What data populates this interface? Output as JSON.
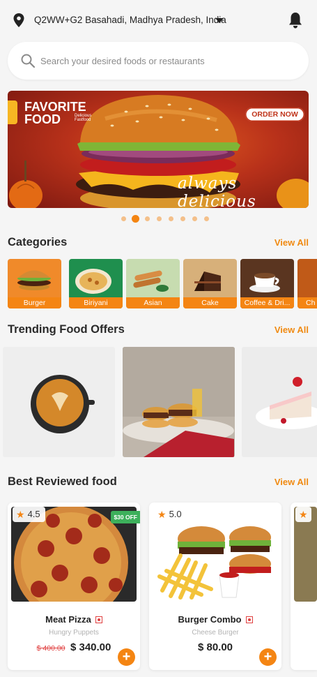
{
  "location": {
    "address": "Q2WW+G2 Basahadi, Madhya Pradesh, India",
    "icon": "location-pin-icon"
  },
  "header": {
    "notification_icon": "bell-icon"
  },
  "search": {
    "placeholder": "Search your desired foods or restaurants",
    "icon": "search-icon"
  },
  "banner": {
    "brand_line1": "FAVORITE",
    "brand_line2": "FOOD",
    "brand_sub": "Delicious Fastfood",
    "cta": "ORDER NOW",
    "tagline": "always delicious",
    "slides_total": 8,
    "active_slide": 2
  },
  "categories": {
    "title": "Categories",
    "view_all": "View All",
    "items": [
      {
        "label": "Burger"
      },
      {
        "label": "Biriyani"
      },
      {
        "label": "Asian"
      },
      {
        "label": "Cake"
      },
      {
        "label": "Coffee & Dri..."
      },
      {
        "label": "Ch"
      }
    ]
  },
  "trending": {
    "title": "Trending Food Offers",
    "view_all": "View All"
  },
  "best_reviewed": {
    "title": "Best Reviewed food",
    "view_all": "View All",
    "items": [
      {
        "rating": "4.5",
        "discount": "$30 OFF",
        "name": "Meat Pizza",
        "restaurant": "Hungry Puppets",
        "old_price": "$ 400.00",
        "price": "$ 340.00"
      },
      {
        "rating": "5.0",
        "discount": "",
        "name": "Burger Combo",
        "restaurant": "Cheese Burger",
        "old_price": "",
        "price": "$ 80.00"
      },
      {
        "rating": "",
        "discount": "",
        "name": "",
        "restaurant": "",
        "old_price": "",
        "price": ""
      }
    ]
  },
  "colors": {
    "accent": "#f48513",
    "discount_badge": "#3db05b",
    "old_price": "#e04040",
    "background": "#f5f5f5"
  }
}
